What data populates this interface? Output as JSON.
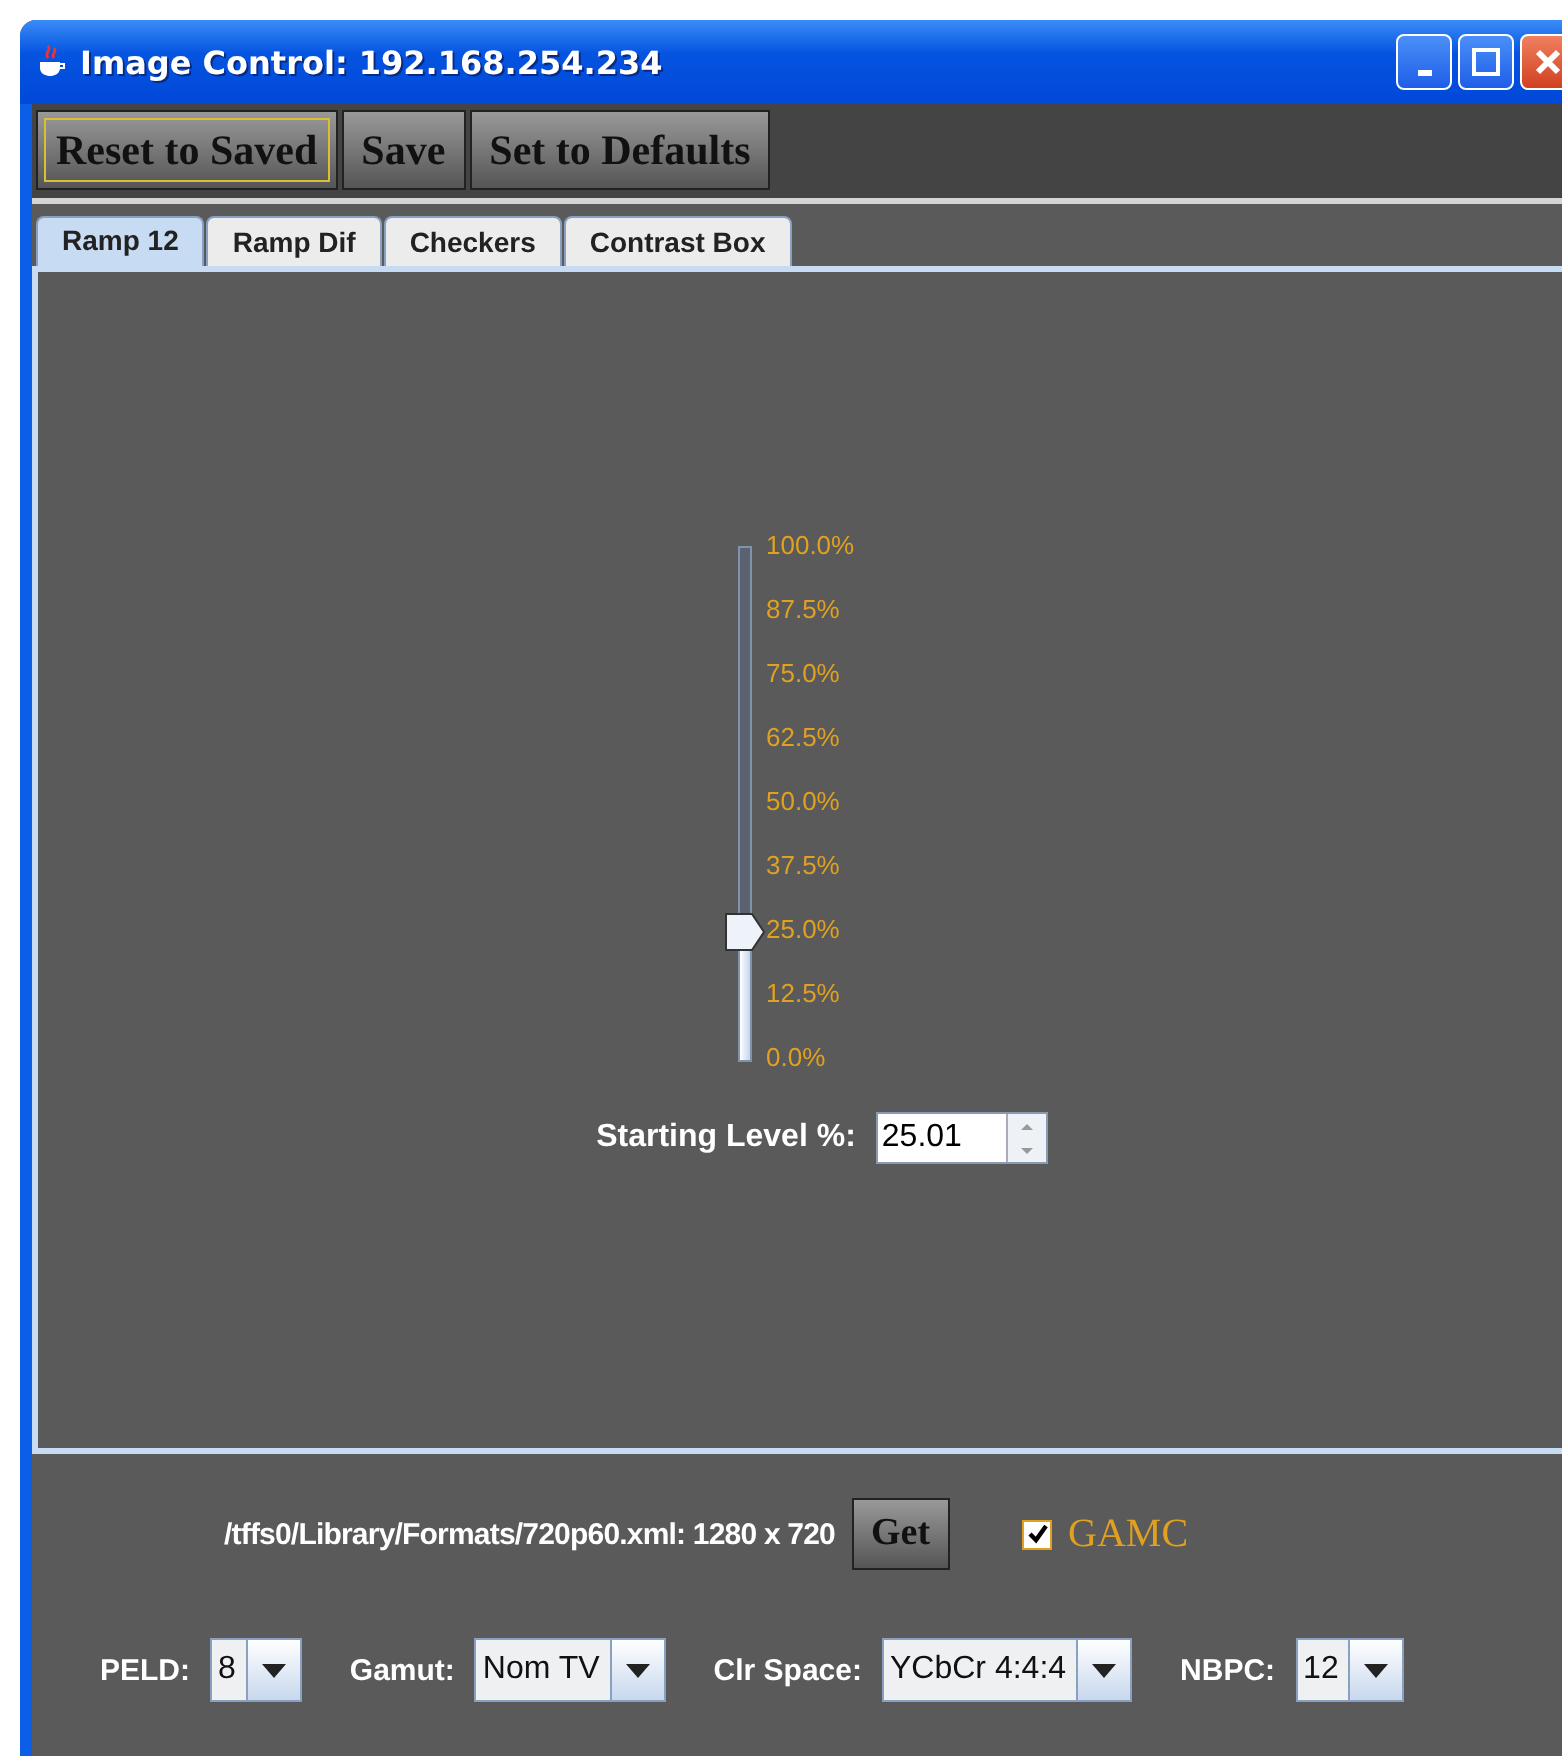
{
  "window": {
    "title": "Image Control: 192.168.254.234"
  },
  "toolbar": [
    {
      "label": "Reset to Saved",
      "focused": true
    },
    {
      "label": "Save",
      "focused": false
    },
    {
      "label": "Set to Defaults",
      "focused": false
    }
  ],
  "tabs": [
    {
      "label": "Ramp 12",
      "selected": true
    },
    {
      "label": "Ramp Dif",
      "selected": false
    },
    {
      "label": "Checkers",
      "selected": false
    },
    {
      "label": "Contrast Box",
      "selected": false
    }
  ],
  "slider": {
    "level": 0.25,
    "ticks": [
      "100.0%",
      "87.5%",
      "75.0%",
      "62.5%",
      "50.0%",
      "37.5%",
      "25.0%",
      "12.5%",
      "0.0%"
    ]
  },
  "starting_level": {
    "label": "Starting Level %:",
    "value": "25.01"
  },
  "format": {
    "path": "/tffs0/Library/Formats/720p60.xml: 1280 x 720",
    "button": "Get"
  },
  "gamc": {
    "label": "GAMC",
    "checked": true
  },
  "selectors": [
    {
      "label": "PELD:",
      "value": "8"
    },
    {
      "label": "Gamut:",
      "value": "Nom TV"
    },
    {
      "label": "Clr Space:",
      "value": "YCbCr 4:4:4"
    },
    {
      "label": "NBPC:",
      "value": "12"
    }
  ]
}
